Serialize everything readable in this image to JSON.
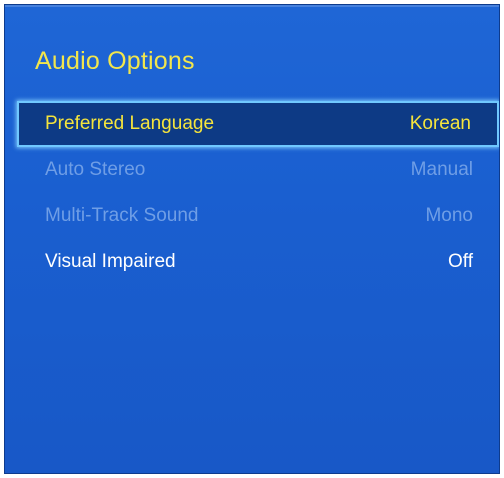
{
  "window": {
    "title": "Audio Options"
  },
  "menu": {
    "items": [
      {
        "label": "Preferred Language",
        "value": "Korean",
        "state": "selected"
      },
      {
        "label": "Auto Stereo",
        "value": "Manual",
        "state": "disabled"
      },
      {
        "label": "Multi-Track Sound",
        "value": "Mono",
        "state": "disabled"
      },
      {
        "label": "Visual Impaired",
        "value": "Off",
        "state": "enabled"
      }
    ]
  },
  "colors": {
    "panel_background": "#1a5fd0",
    "title_text": "#f2e64c",
    "selected_text": "#f5e43c",
    "selected_background": "#0d3a85",
    "selected_border": "#6fc8ff",
    "disabled_text": "#6f9ee6",
    "enabled_text": "#ffffff"
  }
}
